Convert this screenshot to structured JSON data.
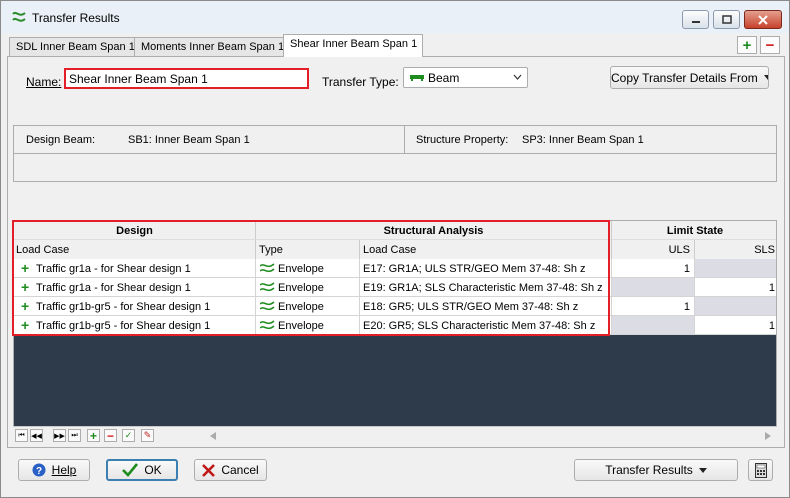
{
  "window": {
    "title": "Transfer Results"
  },
  "tabs": [
    {
      "label": "SDL Inner Beam Span 1"
    },
    {
      "label": "Moments Inner Beam Span 1"
    },
    {
      "label": "Shear Inner Beam Span 1"
    }
  ],
  "form": {
    "name_label": "Name:",
    "name_value": "Shear Inner Beam Span 1",
    "transfer_type_label": "Transfer Type:",
    "transfer_type_value": "Beam",
    "copy_button": "Copy Transfer Details From"
  },
  "info": {
    "design_beam_label": "Design Beam:",
    "design_beam_value": "SB1: Inner Beam Span 1",
    "structure_property_label": "Structure Property:",
    "structure_property_value": "SP3: Inner Beam Span 1"
  },
  "grid": {
    "group_headers": {
      "design": "Design",
      "analysis": "Structural Analysis",
      "limit": "Limit State"
    },
    "columns": {
      "load_case": "Load Case",
      "type": "Type",
      "analysis_load_case": "Load Case",
      "uls": "ULS",
      "sls": "SLS"
    },
    "rows": [
      {
        "load_case": "Traffic gr1a - for Shear design 1",
        "type": "Envelope",
        "analysis": "E17: GR1A; ULS STR/GEO Mem 37-48: Sh z",
        "uls": "1",
        "sls": ""
      },
      {
        "load_case": "Traffic gr1a - for Shear design 1",
        "type": "Envelope",
        "analysis": "E19: GR1A; SLS Characteristic Mem 37-48: Sh z",
        "uls": "",
        "sls": "1"
      },
      {
        "load_case": "Traffic gr1b-gr5 - for Shear design 1",
        "type": "Envelope",
        "analysis": "E18: GR5; ULS STR/GEO Mem 37-48: Sh z",
        "uls": "1",
        "sls": ""
      },
      {
        "load_case": "Traffic gr1b-gr5 - for Shear design 1",
        "type": "Envelope",
        "analysis": "E20: GR5; SLS Characteristic Mem 37-48: Sh z",
        "uls": "",
        "sls": "1"
      }
    ]
  },
  "buttons": {
    "help": "Help",
    "ok": "OK",
    "cancel": "Cancel",
    "transfer_results": "Transfer Results"
  },
  "colors": {
    "highlight": "#e41e26",
    "grid_empty": "#2e3b4a",
    "plus_green": "#1e8c1e"
  }
}
